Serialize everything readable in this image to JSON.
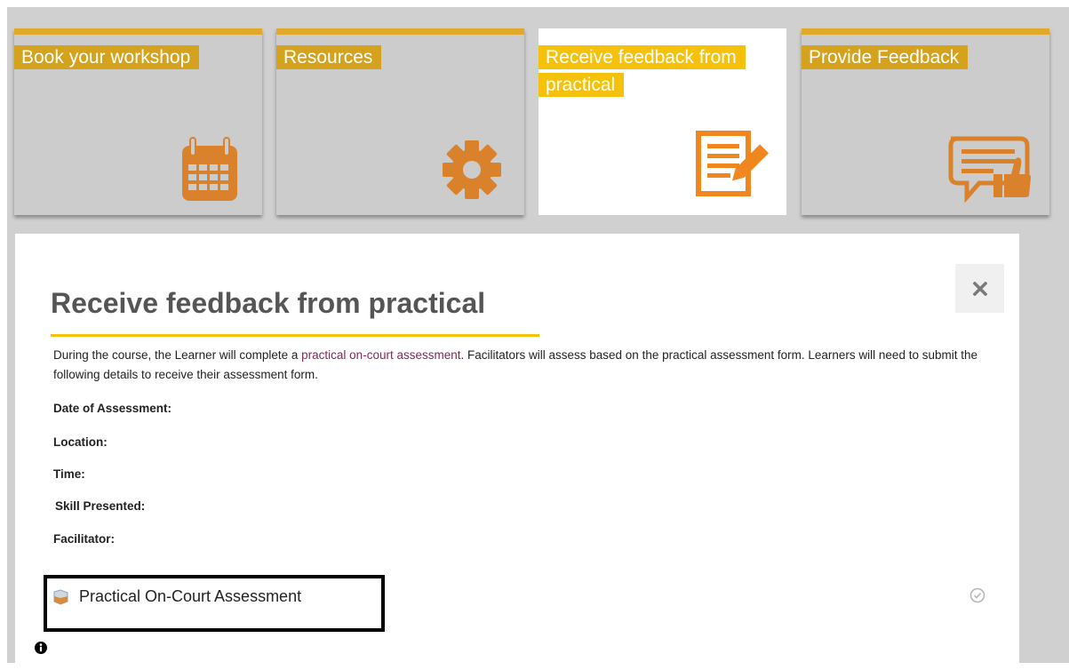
{
  "tiles": [
    {
      "label": "Book your workshop",
      "icon": "calendar-icon",
      "active": false
    },
    {
      "label": "Resources",
      "icon": "gear-icon",
      "active": false
    },
    {
      "label": "Receive feedback from practical",
      "icon": "document-edit-icon",
      "active": true
    },
    {
      "label": "Provide Feedback",
      "icon": "feedback-thumbs-up-icon",
      "active": false
    }
  ],
  "colors": {
    "accent": "#e0a92a",
    "label_bg": "#d4a21c",
    "label_bg_active": "#f5c10b",
    "icon_orange": "#d9822b",
    "link": "#7d2b5a"
  },
  "panel": {
    "title": "Receive feedback from practical",
    "intro_before_link": "During the course, the Learner will complete a ",
    "intro_link": "practical on-court assessment",
    "intro_after_link": ". Facilitators will assess based on the practical assessment form. Learners will need to submit the following details to receive their assessment form.",
    "fields": {
      "date": "Date of Assessment:",
      "location": "Location:",
      "time": "Time:",
      "skill": "Skill Presented:",
      "facilitator": "Facilitator:"
    },
    "activity": {
      "label": "Practical On-Court Assessment",
      "icon": "file-icon",
      "completion_icon": "check-circle-icon"
    },
    "close_icon": "close-icon",
    "info_icon": "info-icon"
  }
}
